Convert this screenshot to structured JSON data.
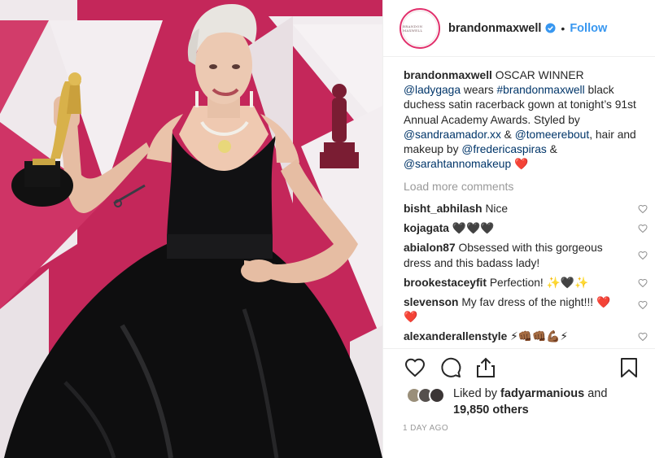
{
  "post": {
    "username": "brandonmaxwell",
    "avatar_text": "BRANDON MAXWELL",
    "follow_label": "Follow",
    "dot": "•"
  },
  "caption": {
    "username": "brandonmaxwell",
    "t1": " OSCAR WINNER ",
    "m1": "@ladygaga",
    "t2": " wears ",
    "m2": "#brandonmaxwell",
    "t3": " black duchess satin racerback gown at tonight’s 91st Annual Academy Awards. Styled by ",
    "m3": "@sandraamador.xx",
    "t4": " & ",
    "m4": "@tomeerebout",
    "t5": ", hair and makeup by ",
    "m5": "@fredericaspiras",
    "t6": " & ",
    "m6": "@sarahtannomakeup",
    "t7": " ❤️"
  },
  "load_more_label": "Load more comments",
  "comments": [
    {
      "user": "bisht_abhilash",
      "text": " Nice"
    },
    {
      "user": "kojagata",
      "text": " 🖤🖤🖤"
    },
    {
      "user": "abialon87",
      "text": " Obsessed with this gorgeous dress and this badass lady!"
    },
    {
      "user": "brookestaceyfit",
      "text": " Perfection! ✨🖤✨"
    },
    {
      "user": "slevenson",
      "text": " My fav dress of the night!!! ❤️❤️"
    },
    {
      "user": "alexanderallenstyle",
      "text": " ⚡👊🏾👊🏾💪🏾⚡"
    }
  ],
  "likes": {
    "prefix": "Liked by ",
    "user": "fadyarmanious",
    "middle": " and ",
    "count": "19,850 others"
  },
  "timestamp": "1 DAY AGO",
  "icons": {
    "verified": "verified-badge-icon",
    "like": "heart-outline-icon",
    "comment": "speech-bubble-icon",
    "share": "share-upload-icon",
    "save": "bookmark-icon"
  },
  "colors": {
    "accent": "#3897f0",
    "mention": "#003569",
    "muted": "#999999",
    "background_photo": "#c8265a"
  }
}
